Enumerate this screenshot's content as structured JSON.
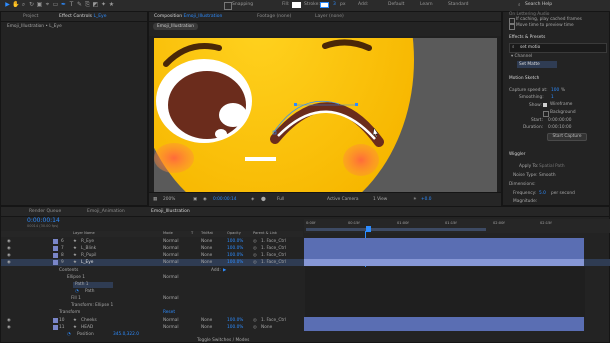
{
  "toolbar": {
    "snapping": "Snapping",
    "fill_label": "Fill:",
    "stroke_label": "Stroke:",
    "stroke_px": "3",
    "stroke_unit": "px",
    "add_label": "Add:",
    "workspaces": [
      "Default",
      "Learn",
      "Standard"
    ],
    "search": "Search Help"
  },
  "project_panel": {
    "tab_project": "Project",
    "tab_effect_controls": "Effect Controls",
    "effect_controls_target": "L_Eye",
    "subtitle": "Emoji_Illustration • L_Eye"
  },
  "comp_panel": {
    "tab_label": "Composition",
    "comp_name": "Emoji_Illustration",
    "footage_tab": "Footage (none)",
    "layer_tab": "Layer (none)",
    "breadcrumb": "Emoji_Illustration",
    "zoom": "200%",
    "timecode": "0:00:00:14",
    "resolution": "Full",
    "camera": "Active Camera",
    "views": "1 View",
    "exposure": "+0.0"
  },
  "right_panel": {
    "top_lines": [
      "On Lettering Audio",
      "If caching, play cached frames",
      "Move time to preview time"
    ],
    "effects_presets": "Effects & Presets",
    "search_value": "set motio",
    "category": "Channel",
    "result": "Set Matte",
    "motion_sketch": "Motion Sketch",
    "capture_speed_label": "Capture speed at:",
    "capture_speed_value": "100",
    "capture_speed_unit": "%",
    "smoothing_label": "Smoothing:",
    "smoothing_value": "1",
    "show_label": "Show:",
    "show_wireframe": "Wireframe",
    "show_background": "Background",
    "start_label": "Start:",
    "start_value": "0:00:00:00",
    "duration_label": "Duration:",
    "duration_value": "0:00:10:00",
    "start_capture": "Start Capture",
    "wiggler": "Wiggler",
    "apply_to_label": "Apply To:",
    "apply_to_value": "Spatial Path",
    "noise_type_label": "Noise Type:",
    "noise_type_value": "Smooth",
    "dimensions_label": "Dimensions:",
    "frequency_label": "Frequency:",
    "frequency_value": "5.0",
    "frequency_unit": "per second",
    "magnitude_label": "Magnitude:"
  },
  "timeline": {
    "tabs": [
      "Render Queue",
      "Emoji_Animation",
      "Emoji_Illustration"
    ],
    "timecode": "0:00:00:14",
    "fps_note": "00014 (30.00 fps)",
    "columns": [
      "Layer Name",
      "Mode",
      "T",
      "TrkMat",
      "Opacity",
      "Parent & Link"
    ],
    "ruler": [
      "0:00f",
      "00:15f",
      "01:00f",
      "01:15f",
      "02:00f",
      "02:15f"
    ],
    "layers": [
      {
        "num": "6",
        "name": "R_Eye",
        "mode": "Normal",
        "trk": "None",
        "opacity": "100.0%",
        "parent": "1. Face_Ctrl"
      },
      {
        "num": "7",
        "name": "L_Blink",
        "mode": "Normal",
        "trk": "None",
        "opacity": "100.0%",
        "parent": "1. Face_Ctrl"
      },
      {
        "num": "8",
        "name": "R_Pupil",
        "mode": "Normal",
        "trk": "None",
        "opacity": "100.0%",
        "parent": "1. Face_Ctrl"
      },
      {
        "num": "9",
        "name": "L_Eye",
        "mode": "Normal",
        "trk": "None",
        "opacity": "100.0%",
        "parent": "1. Face_Ctrl"
      }
    ],
    "contents": "Contents",
    "add": "Add:",
    "ellipse": "Ellipse 1",
    "ellipse_mode": "Normal",
    "path1": "Path 1",
    "path_prop": "Path",
    "fill1": "Fill 1",
    "fill_mode": "Normal",
    "transform": "Transform: Ellipse 1",
    "transform_prop": "Transform",
    "reset": "Reset",
    "layers2": [
      {
        "num": "10",
        "name": "Cheeks",
        "mode": "Normal",
        "trk": "None",
        "opacity": "100.0%",
        "parent": "1. Face_Ctrl"
      },
      {
        "num": "11",
        "name": "HEAD",
        "mode": "Normal",
        "trk": "None",
        "opacity": "100.0%",
        "parent": "None"
      }
    ],
    "position_label": "Position",
    "position_value": "345.0,322.0",
    "footer": "Toggle Switches / Modes"
  }
}
